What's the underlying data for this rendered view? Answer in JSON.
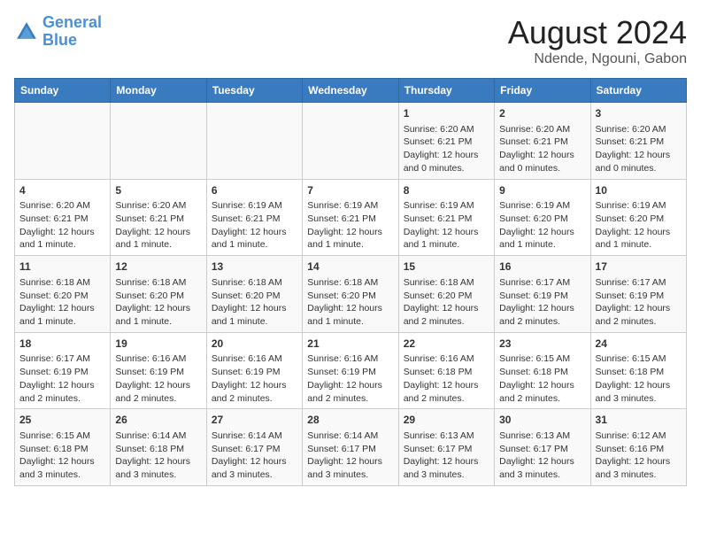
{
  "logo": {
    "line1": "General",
    "line2": "Blue"
  },
  "title": "August 2024",
  "subtitle": "Ndende, Ngouni, Gabon",
  "days_of_week": [
    "Sunday",
    "Monday",
    "Tuesday",
    "Wednesday",
    "Thursday",
    "Friday",
    "Saturday"
  ],
  "weeks": [
    [
      {
        "day": "",
        "info": ""
      },
      {
        "day": "",
        "info": ""
      },
      {
        "day": "",
        "info": ""
      },
      {
        "day": "",
        "info": ""
      },
      {
        "day": "1",
        "info": "Sunrise: 6:20 AM\nSunset: 6:21 PM\nDaylight: 12 hours\nand 0 minutes."
      },
      {
        "day": "2",
        "info": "Sunrise: 6:20 AM\nSunset: 6:21 PM\nDaylight: 12 hours\nand 0 minutes."
      },
      {
        "day": "3",
        "info": "Sunrise: 6:20 AM\nSunset: 6:21 PM\nDaylight: 12 hours\nand 0 minutes."
      }
    ],
    [
      {
        "day": "4",
        "info": "Sunrise: 6:20 AM\nSunset: 6:21 PM\nDaylight: 12 hours\nand 1 minute."
      },
      {
        "day": "5",
        "info": "Sunrise: 6:20 AM\nSunset: 6:21 PM\nDaylight: 12 hours\nand 1 minute."
      },
      {
        "day": "6",
        "info": "Sunrise: 6:19 AM\nSunset: 6:21 PM\nDaylight: 12 hours\nand 1 minute."
      },
      {
        "day": "7",
        "info": "Sunrise: 6:19 AM\nSunset: 6:21 PM\nDaylight: 12 hours\nand 1 minute."
      },
      {
        "day": "8",
        "info": "Sunrise: 6:19 AM\nSunset: 6:21 PM\nDaylight: 12 hours\nand 1 minute."
      },
      {
        "day": "9",
        "info": "Sunrise: 6:19 AM\nSunset: 6:20 PM\nDaylight: 12 hours\nand 1 minute."
      },
      {
        "day": "10",
        "info": "Sunrise: 6:19 AM\nSunset: 6:20 PM\nDaylight: 12 hours\nand 1 minute."
      }
    ],
    [
      {
        "day": "11",
        "info": "Sunrise: 6:18 AM\nSunset: 6:20 PM\nDaylight: 12 hours\nand 1 minute."
      },
      {
        "day": "12",
        "info": "Sunrise: 6:18 AM\nSunset: 6:20 PM\nDaylight: 12 hours\nand 1 minute."
      },
      {
        "day": "13",
        "info": "Sunrise: 6:18 AM\nSunset: 6:20 PM\nDaylight: 12 hours\nand 1 minute."
      },
      {
        "day": "14",
        "info": "Sunrise: 6:18 AM\nSunset: 6:20 PM\nDaylight: 12 hours\nand 1 minute."
      },
      {
        "day": "15",
        "info": "Sunrise: 6:18 AM\nSunset: 6:20 PM\nDaylight: 12 hours\nand 2 minutes."
      },
      {
        "day": "16",
        "info": "Sunrise: 6:17 AM\nSunset: 6:19 PM\nDaylight: 12 hours\nand 2 minutes."
      },
      {
        "day": "17",
        "info": "Sunrise: 6:17 AM\nSunset: 6:19 PM\nDaylight: 12 hours\nand 2 minutes."
      }
    ],
    [
      {
        "day": "18",
        "info": "Sunrise: 6:17 AM\nSunset: 6:19 PM\nDaylight: 12 hours\nand 2 minutes."
      },
      {
        "day": "19",
        "info": "Sunrise: 6:16 AM\nSunset: 6:19 PM\nDaylight: 12 hours\nand 2 minutes."
      },
      {
        "day": "20",
        "info": "Sunrise: 6:16 AM\nSunset: 6:19 PM\nDaylight: 12 hours\nand 2 minutes."
      },
      {
        "day": "21",
        "info": "Sunrise: 6:16 AM\nSunset: 6:19 PM\nDaylight: 12 hours\nand 2 minutes."
      },
      {
        "day": "22",
        "info": "Sunrise: 6:16 AM\nSunset: 6:18 PM\nDaylight: 12 hours\nand 2 minutes."
      },
      {
        "day": "23",
        "info": "Sunrise: 6:15 AM\nSunset: 6:18 PM\nDaylight: 12 hours\nand 2 minutes."
      },
      {
        "day": "24",
        "info": "Sunrise: 6:15 AM\nSunset: 6:18 PM\nDaylight: 12 hours\nand 3 minutes."
      }
    ],
    [
      {
        "day": "25",
        "info": "Sunrise: 6:15 AM\nSunset: 6:18 PM\nDaylight: 12 hours\nand 3 minutes."
      },
      {
        "day": "26",
        "info": "Sunrise: 6:14 AM\nSunset: 6:18 PM\nDaylight: 12 hours\nand 3 minutes."
      },
      {
        "day": "27",
        "info": "Sunrise: 6:14 AM\nSunset: 6:17 PM\nDaylight: 12 hours\nand 3 minutes."
      },
      {
        "day": "28",
        "info": "Sunrise: 6:14 AM\nSunset: 6:17 PM\nDaylight: 12 hours\nand 3 minutes."
      },
      {
        "day": "29",
        "info": "Sunrise: 6:13 AM\nSunset: 6:17 PM\nDaylight: 12 hours\nand 3 minutes."
      },
      {
        "day": "30",
        "info": "Sunrise: 6:13 AM\nSunset: 6:17 PM\nDaylight: 12 hours\nand 3 minutes."
      },
      {
        "day": "31",
        "info": "Sunrise: 6:12 AM\nSunset: 6:16 PM\nDaylight: 12 hours\nand 3 minutes."
      }
    ]
  ]
}
